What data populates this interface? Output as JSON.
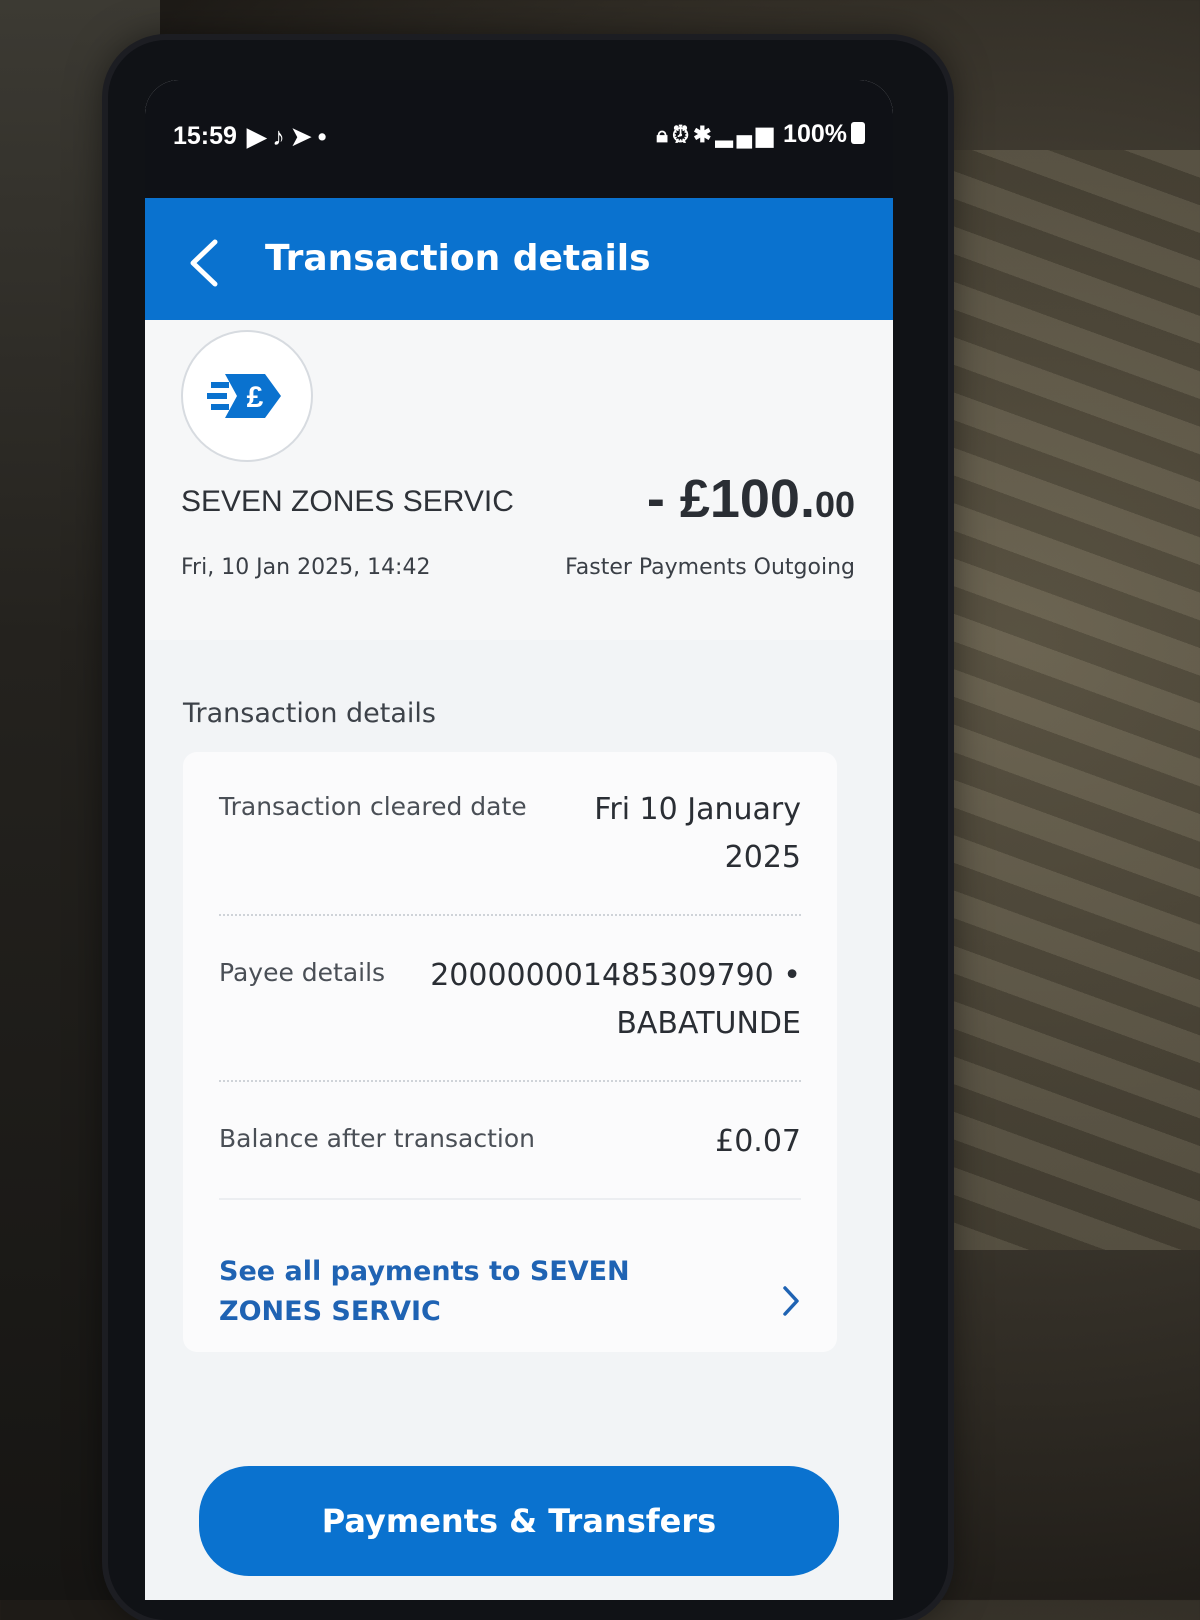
{
  "status_bar": {
    "time": "15:59",
    "left_icons": [
      "youtube-icon",
      "tiktok-icon",
      "telegram-icon",
      "dot-icon"
    ],
    "right_icons": [
      "lock-icon",
      "alarm-icon",
      "bluetooth-icon",
      "data-icon",
      "signal-icon",
      "signal-icon"
    ],
    "battery": "100%"
  },
  "header": {
    "title": "Transaction details",
    "back_icon": "chevron-left-icon"
  },
  "summary": {
    "merchant_icon": "faster-payment-pound-icon",
    "merchant_name": "SEVEN ZONES SERVIC",
    "amount_main": "- £100.",
    "amount_pence": "00",
    "date": "Fri, 10 Jan 2025, 14:42",
    "type": "Faster Payments Outgoing"
  },
  "details": {
    "section_title": "Transaction details",
    "rows": [
      {
        "label": "Transaction cleared date",
        "value_line1": "Fri 10 January",
        "value_line2": "2025"
      },
      {
        "label": "Payee details",
        "value_line1": "200000001485309790 •",
        "value_line2": "BABATUNDE"
      },
      {
        "label": "Balance after transaction",
        "value_line1": "£0.07"
      }
    ],
    "link_text": "See all payments to SEVEN ZONES SERVIC"
  },
  "cta": {
    "label": "Payments & Transfers"
  },
  "colors": {
    "brand_blue": "#0a72cf",
    "link_blue": "#1f63b3"
  }
}
